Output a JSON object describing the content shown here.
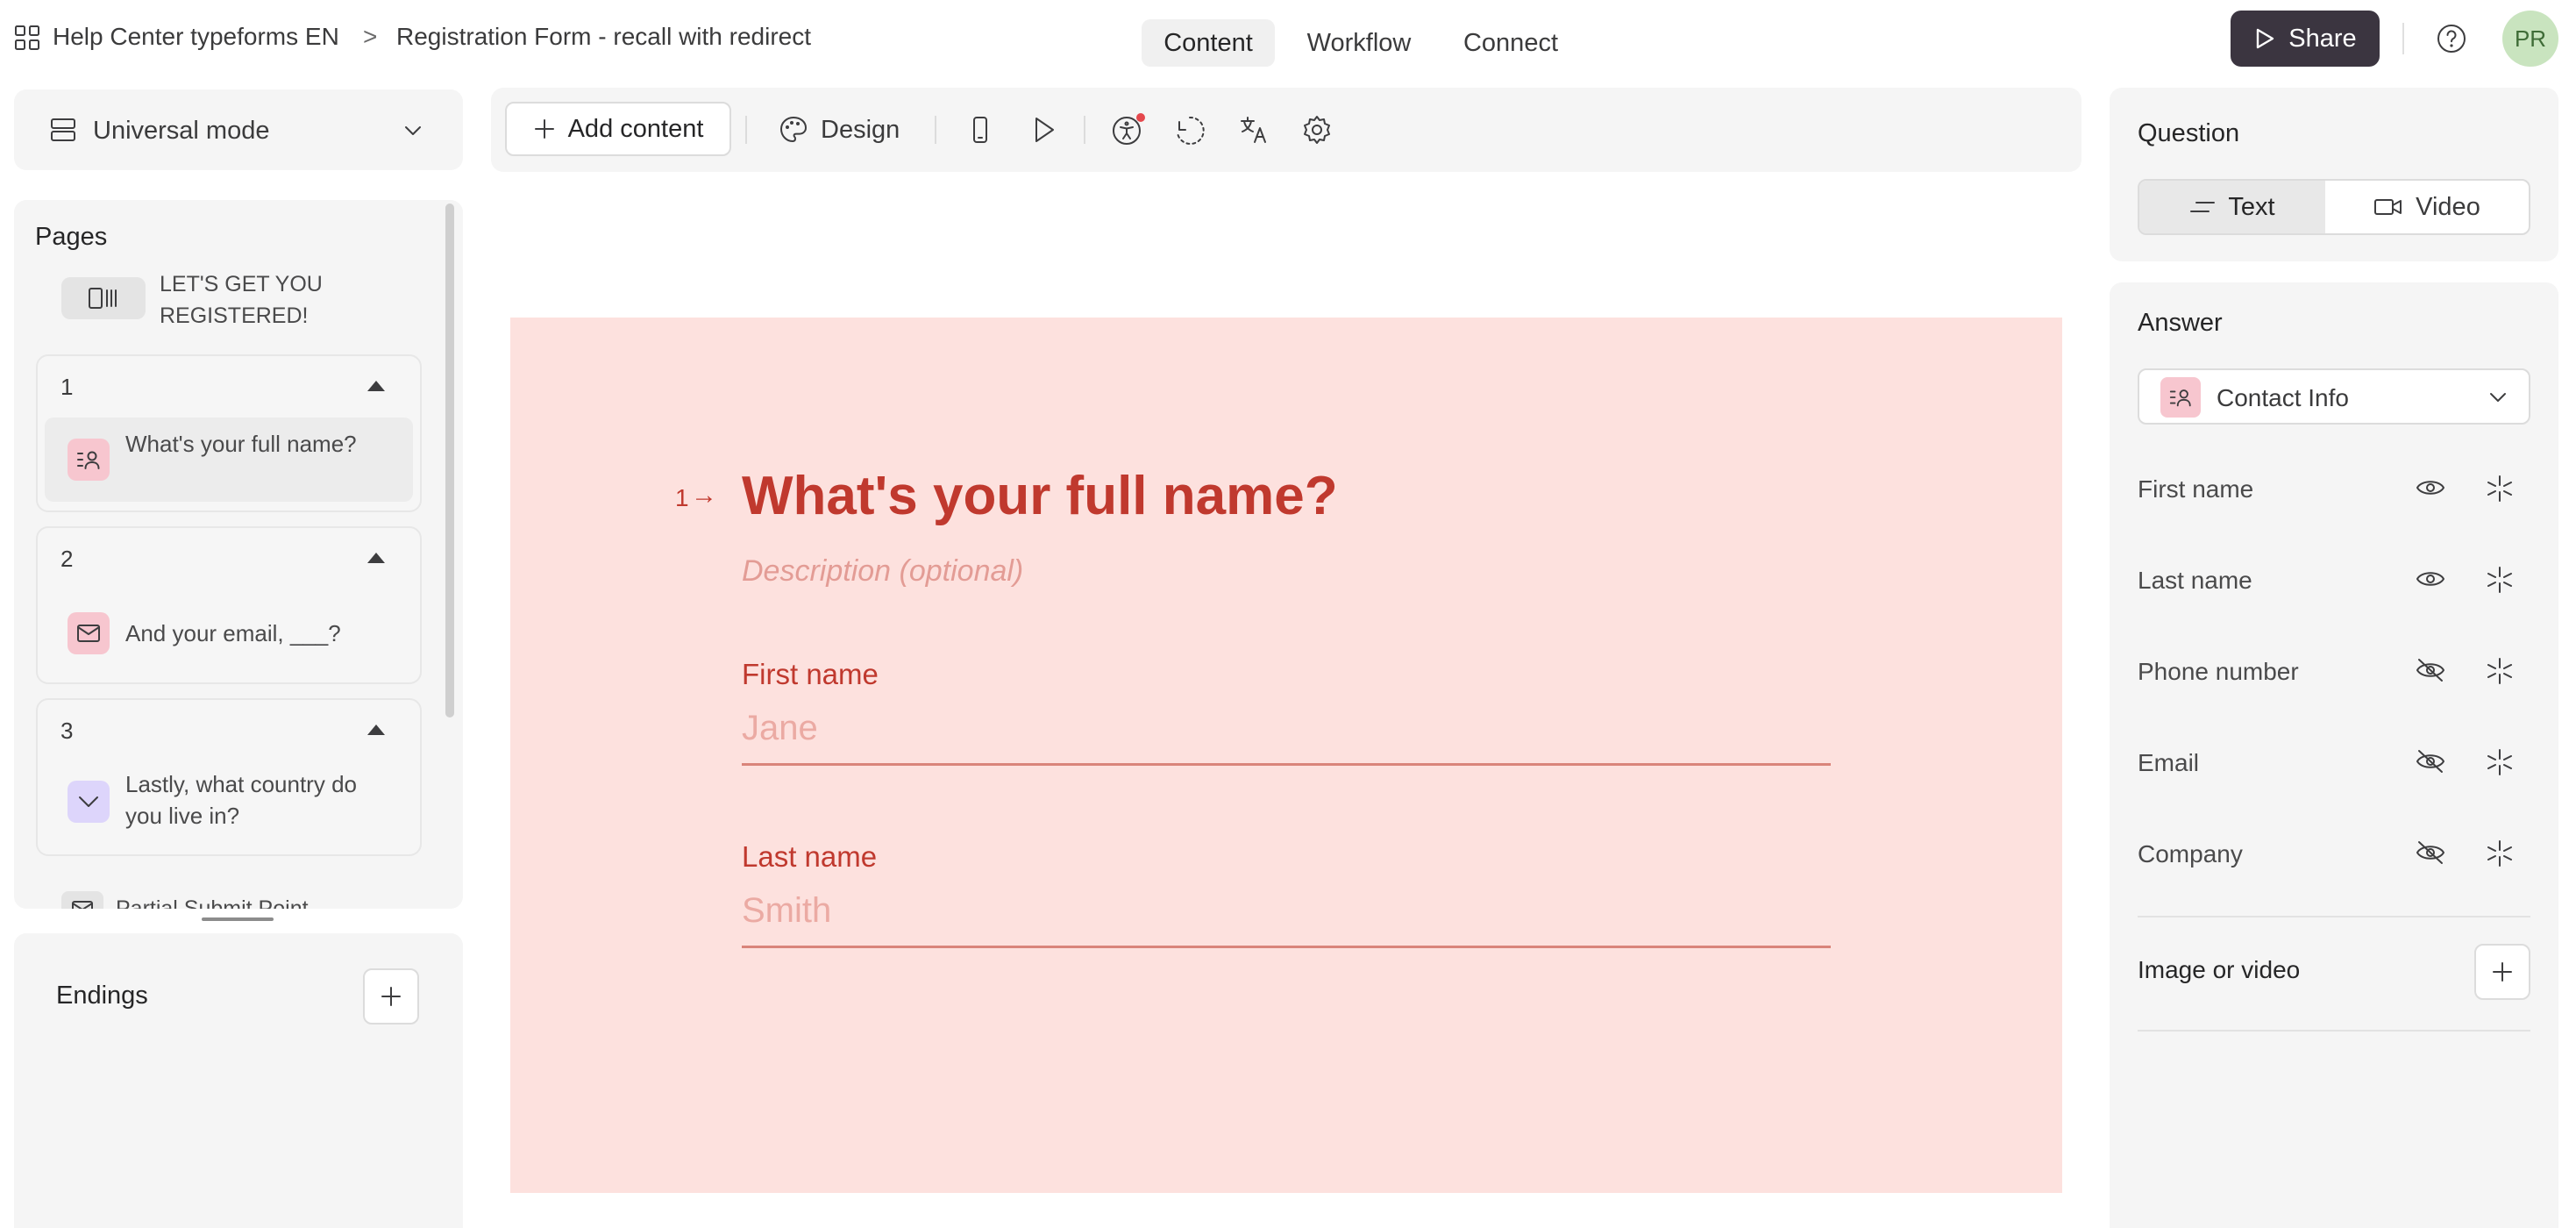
{
  "topbar": {
    "breadcrumb": {
      "workspace": "Help Center typeforms EN",
      "separator": ">",
      "form": "Registration Form - recall with redirect"
    },
    "tabs": [
      {
        "label": "Content",
        "active": true
      },
      {
        "label": "Workflow",
        "active": false
      },
      {
        "label": "Connect",
        "active": false
      }
    ],
    "share_label": "Share",
    "avatar_initials": "PR",
    "icons": [
      "apps-grid-icon",
      "help-circle-icon",
      "send-icon"
    ]
  },
  "left_panel": {
    "mode_label": "Universal mode",
    "pages_title": "Pages",
    "welcome_screen": {
      "label": "LET'S GET YOU REGISTERED!"
    },
    "pages": [
      {
        "number": "1",
        "question": "What's your full name?",
        "icon": "contact-info-icon",
        "selected": true
      },
      {
        "number": "2",
        "question": "And your email, ___?",
        "icon": "email-icon",
        "selected": false
      },
      {
        "number": "3",
        "question": "Lastly, what country do you live in?",
        "icon": "dropdown-icon",
        "selected": false
      }
    ],
    "partial_label": "Partial Submit Point",
    "endings_title": "Endings"
  },
  "toolbar": {
    "add_content_label": "Add content",
    "design_label": "Design",
    "icons": [
      "plus-icon",
      "palette-icon",
      "mobile-preview-icon",
      "play-icon",
      "accessibility-icon",
      "history-icon",
      "translate-icon",
      "settings-icon"
    ]
  },
  "canvas": {
    "question_number": "1",
    "arrow": "→",
    "question_title": "What's your full name?",
    "description_placeholder": "Description (optional)",
    "fields": [
      {
        "label": "First name",
        "placeholder": "Jane"
      },
      {
        "label": "Last name",
        "placeholder": "Smith"
      }
    ],
    "colors": {
      "background": "#fde1de",
      "accent": "#c0392e"
    }
  },
  "right_panel": {
    "question_title": "Question",
    "question_types": [
      {
        "label": "Text",
        "active": true,
        "icon": "text-lines-icon"
      },
      {
        "label": "Video",
        "active": false,
        "icon": "video-icon"
      }
    ],
    "answer_title": "Answer",
    "answer_type": "Contact Info",
    "fields": [
      {
        "label": "First name",
        "visible": true,
        "required": true
      },
      {
        "label": "Last name",
        "visible": true,
        "required": true
      },
      {
        "label": "Phone number",
        "visible": false,
        "required": false
      },
      {
        "label": "Email",
        "visible": false,
        "required": false
      },
      {
        "label": "Company",
        "visible": false,
        "required": false
      }
    ],
    "media_label": "Image or video"
  }
}
